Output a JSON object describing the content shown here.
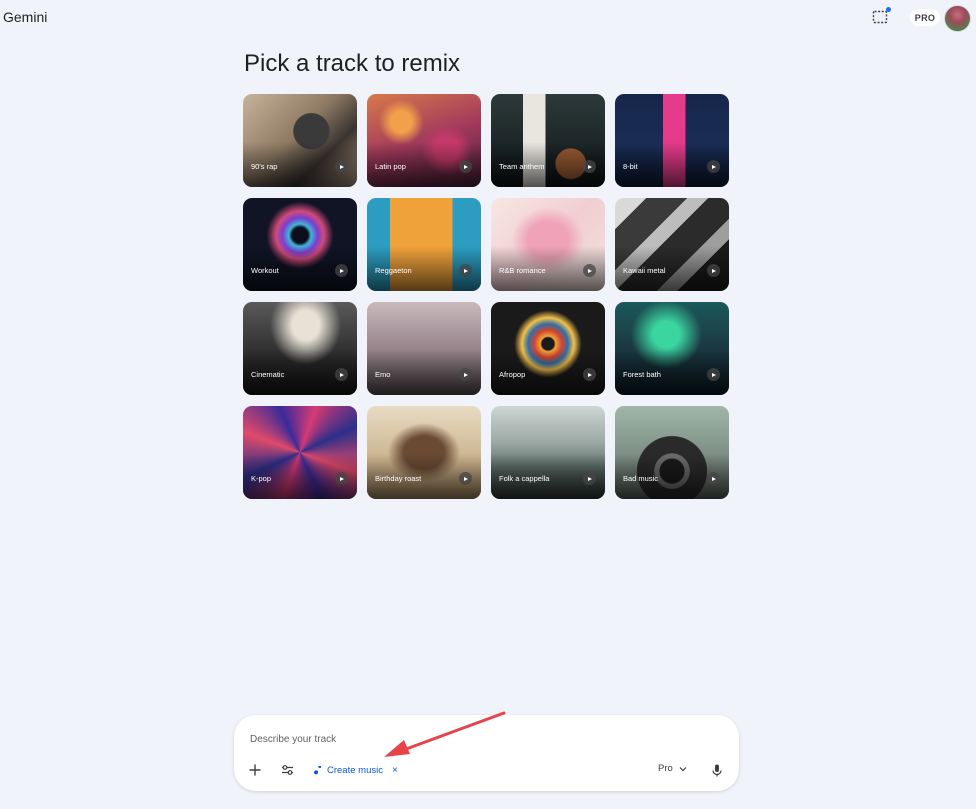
{
  "header": {
    "app_title": "Gemini",
    "pro_badge": "PRO"
  },
  "main": {
    "title": "Pick a track to remix",
    "tracks": [
      {
        "label": "90's rap"
      },
      {
        "label": "Latin pop"
      },
      {
        "label": "Team anthem"
      },
      {
        "label": "8-bit"
      },
      {
        "label": "Workout"
      },
      {
        "label": "Reggaeton"
      },
      {
        "label": "R&B romance"
      },
      {
        "label": "Kawaii metal"
      },
      {
        "label": "Cinematic"
      },
      {
        "label": "Emo"
      },
      {
        "label": "Afropop"
      },
      {
        "label": "Forest bath"
      },
      {
        "label": "K-pop"
      },
      {
        "label": "Birthday roast"
      },
      {
        "label": "Folk a cappella"
      },
      {
        "label": "Bad music"
      }
    ]
  },
  "composer": {
    "placeholder": "Describe your track",
    "tool_chip": "Create music",
    "tool_chip_close": "×",
    "model": "Pro"
  },
  "colors": {
    "background": "#f0f3f9",
    "accent": "#0b57d0",
    "annotation_arrow": "#e8424a"
  }
}
